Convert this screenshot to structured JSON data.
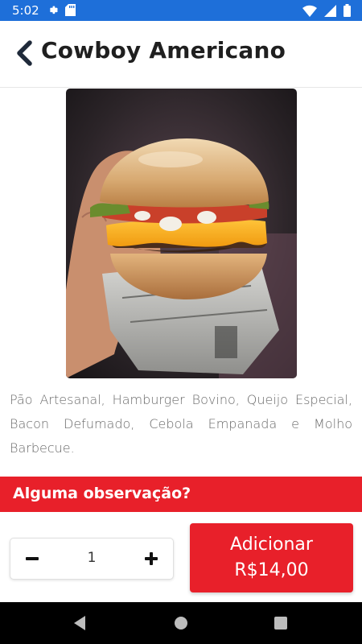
{
  "status_bar": {
    "time": "5:02",
    "left_icons": [
      "settings-icon",
      "sd-card-icon"
    ],
    "right_icons": [
      "wifi-icon",
      "signal-icon",
      "battery-icon"
    ],
    "color": "#1e6fd9"
  },
  "header": {
    "back_icon": "chevron-left-icon",
    "title": "Cowboy Americano"
  },
  "product": {
    "image": "burger-photo",
    "description": "Pão Artesanal, Hamburger Bovino, Queijo Especial, Bacon Defumado, Cebola Empanada e Molho Barbecue."
  },
  "observation": {
    "label": "Alguma observação?",
    "color": "#e8202a"
  },
  "quantity": {
    "minus_icon": "minus-icon",
    "value": "1",
    "plus_icon": "plus-icon"
  },
  "add_button": {
    "label": "Adicionar",
    "price": "R$14,00",
    "color": "#e8202a"
  },
  "nav_bar": {
    "icons": [
      "back-triangle-icon",
      "home-circle-icon",
      "recents-square-icon"
    ]
  }
}
